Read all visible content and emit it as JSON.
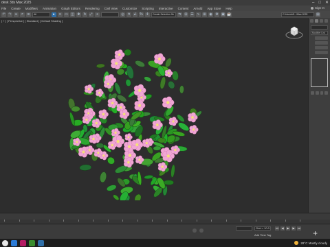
{
  "window": {
    "title": "desk 3ds Max 2025"
  },
  "menu": {
    "items": [
      "File",
      "Create",
      "Modifiers",
      "Animation",
      "Graph Editors",
      "Rendering",
      "Civil View",
      "Customize",
      "Scripting",
      "Interactive",
      "Content",
      "Arnold",
      "App Store",
      "Help"
    ],
    "sign_in": "Sign In"
  },
  "toolbar": {
    "selection_filter": "All",
    "selection_set": "Create Selection Se",
    "workspace": "C:\\Users\\D...\\Max 2025"
  },
  "left_strip": {
    "label": "Loading"
  },
  "viewport": {
    "label": "[ + ] [ Perspective ] [ Standard ] [ Default Shading ]"
  },
  "right_panel": {
    "modifier_list": "Modifier List"
  },
  "status": {
    "x_field": "",
    "y_field": "Grid = 10.0",
    "add_time_tag": "Add Time Tag"
  },
  "taskbar": {
    "weather": "28°C  Mostly cloudy"
  },
  "colors": {
    "accent": "#2f6fa8",
    "petal": "#f0a6d4",
    "petal_center": "#f5e07a",
    "leaf": "#3d9a3a"
  },
  "icons": [
    "minimize-icon",
    "maximize-icon",
    "close-icon",
    "undo-icon",
    "redo-icon",
    "link-icon",
    "select-icon",
    "move-icon",
    "rotate-icon",
    "scale-icon",
    "snap-icon",
    "render-icon",
    "viewcube-icon",
    "play-icon"
  ]
}
